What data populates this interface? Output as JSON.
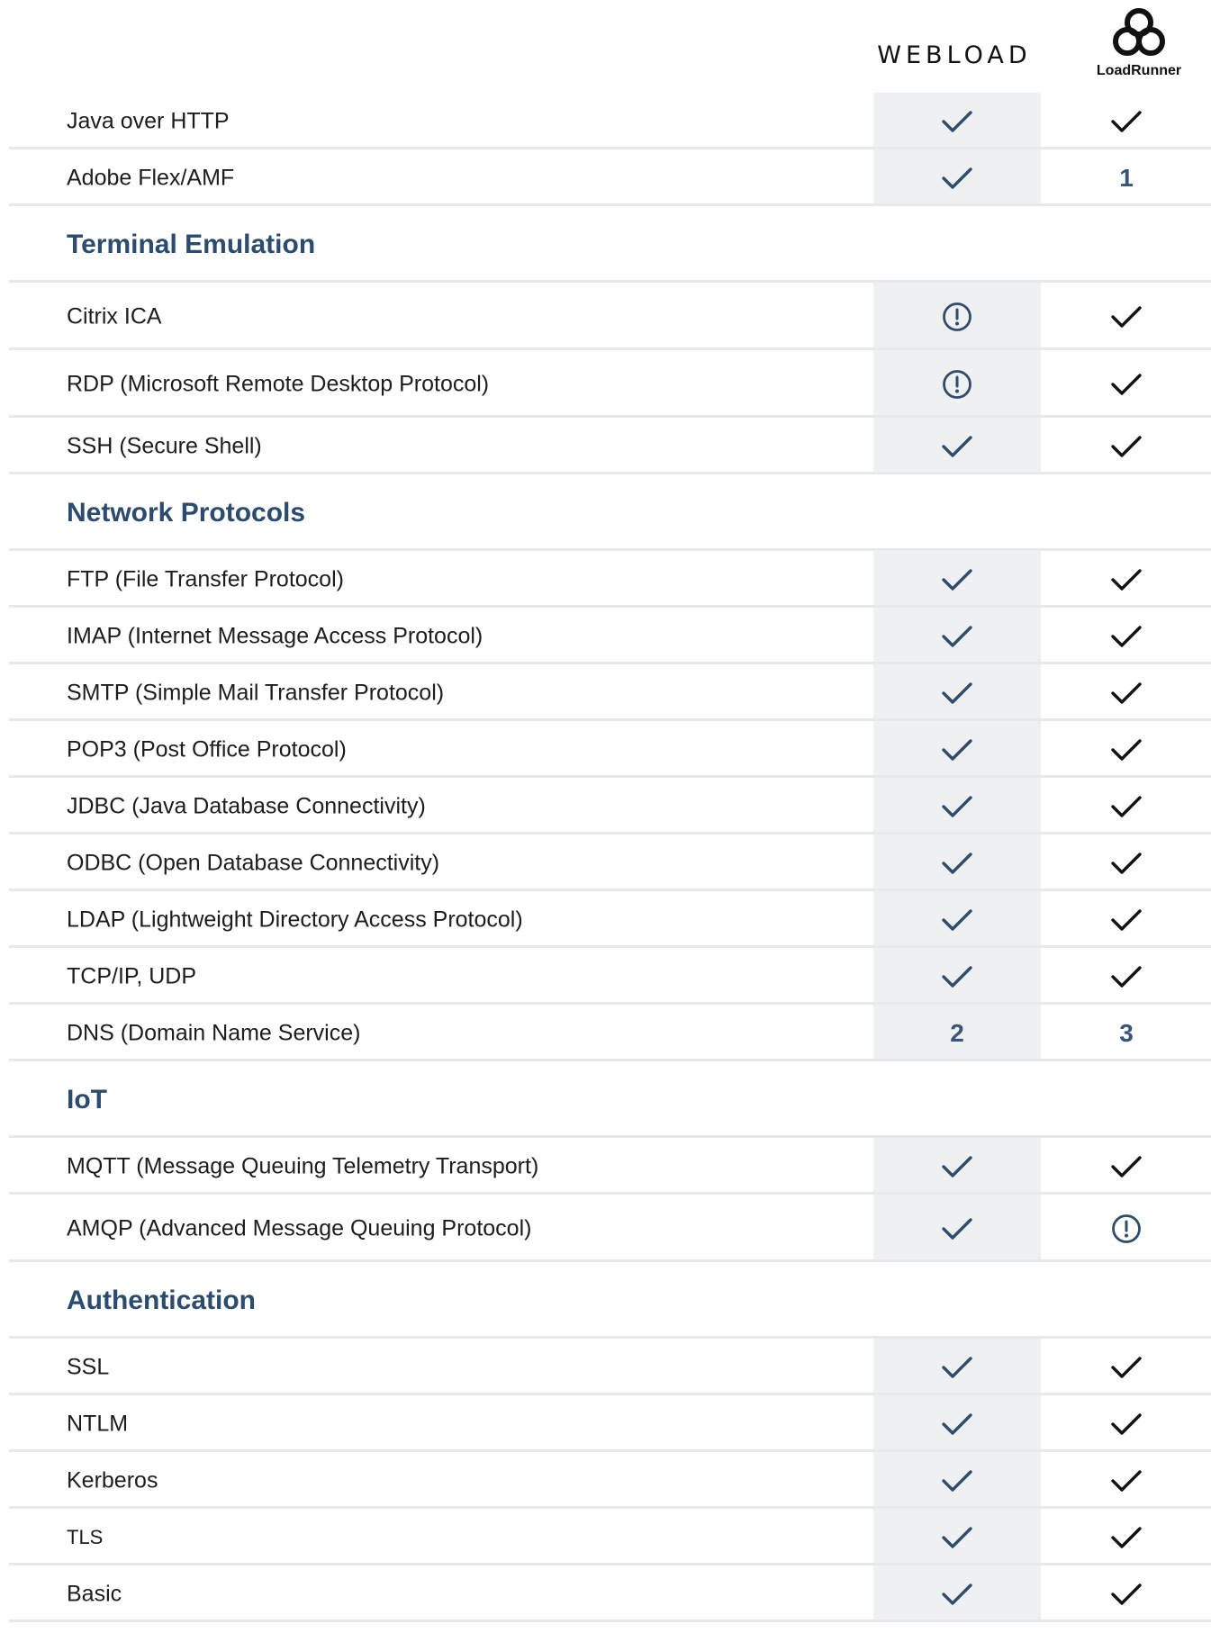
{
  "header": {
    "webload_logo": "WEBLOAD",
    "loadrunner_logo": "LoadRunner"
  },
  "colors": {
    "webload_check": "#2f4c6c",
    "loadrunner_check": "#111111",
    "section_heading": "#2b4b6f",
    "webload_column_bg": "#eff0f2",
    "row_divider": "#e7e8ea"
  },
  "rows": [
    {
      "type": "item",
      "label": "Java over HTTP",
      "webload": {
        "kind": "check"
      },
      "loadrunner": {
        "kind": "check"
      }
    },
    {
      "type": "item",
      "label": "Adobe Flex/AMF",
      "webload": {
        "kind": "check"
      },
      "loadrunner": {
        "kind": "text",
        "value": "1"
      }
    },
    {
      "type": "section",
      "label": "Terminal Emulation"
    },
    {
      "type": "item",
      "tall": true,
      "label": "Citrix ICA",
      "webload": {
        "kind": "warning"
      },
      "loadrunner": {
        "kind": "check"
      }
    },
    {
      "type": "item",
      "tall": true,
      "label": "RDP (Microsoft Remote Desktop Protocol)",
      "webload": {
        "kind": "warning"
      },
      "loadrunner": {
        "kind": "check"
      }
    },
    {
      "type": "item",
      "label": "SSH (Secure Shell)",
      "webload": {
        "kind": "check"
      },
      "loadrunner": {
        "kind": "check"
      }
    },
    {
      "type": "section",
      "label": "Network Protocols"
    },
    {
      "type": "item",
      "label": "FTP (File Transfer Protocol)",
      "webload": {
        "kind": "check"
      },
      "loadrunner": {
        "kind": "check"
      }
    },
    {
      "type": "item",
      "label": "IMAP (Internet Message Access Protocol)",
      "webload": {
        "kind": "check"
      },
      "loadrunner": {
        "kind": "check"
      }
    },
    {
      "type": "item",
      "label": "SMTP (Simple Mail Transfer Protocol)",
      "webload": {
        "kind": "check"
      },
      "loadrunner": {
        "kind": "check"
      }
    },
    {
      "type": "item",
      "label": "POP3 (Post Office Protocol)",
      "webload": {
        "kind": "check"
      },
      "loadrunner": {
        "kind": "check"
      }
    },
    {
      "type": "item",
      "label": "JDBC (Java Database Connectivity)",
      "webload": {
        "kind": "check"
      },
      "loadrunner": {
        "kind": "check"
      }
    },
    {
      "type": "item",
      "label": "ODBC (Open Database Connectivity)",
      "webload": {
        "kind": "check"
      },
      "loadrunner": {
        "kind": "check"
      }
    },
    {
      "type": "item",
      "label": "LDAP (Lightweight Directory Access Protocol)",
      "webload": {
        "kind": "check"
      },
      "loadrunner": {
        "kind": "check"
      }
    },
    {
      "type": "item",
      "label": "TCP/IP, UDP",
      "webload": {
        "kind": "check"
      },
      "loadrunner": {
        "kind": "check"
      }
    },
    {
      "type": "item",
      "label": "DNS (Domain Name Service)",
      "webload": {
        "kind": "text",
        "value": "2"
      },
      "loadrunner": {
        "kind": "text",
        "value": "3"
      }
    },
    {
      "type": "section",
      "label": "IoT"
    },
    {
      "type": "item",
      "label": "MQTT (Message Queuing Telemetry Transport)",
      "webload": {
        "kind": "check"
      },
      "loadrunner": {
        "kind": "check"
      }
    },
    {
      "type": "item",
      "tall": true,
      "label": "AMQP (Advanced Message Queuing Protocol)",
      "webload": {
        "kind": "check"
      },
      "loadrunner": {
        "kind": "warning"
      }
    },
    {
      "type": "section",
      "label": "Authentication"
    },
    {
      "type": "item",
      "label": "SSL",
      "webload": {
        "kind": "check"
      },
      "loadrunner": {
        "kind": "check"
      }
    },
    {
      "type": "item",
      "label": "NTLM",
      "webload": {
        "kind": "check"
      },
      "loadrunner": {
        "kind": "check"
      }
    },
    {
      "type": "item",
      "label": "Kerberos",
      "webload": {
        "kind": "check"
      },
      "loadrunner": {
        "kind": "check"
      }
    },
    {
      "type": "item",
      "small": true,
      "label": "TLS",
      "webload": {
        "kind": "check"
      },
      "loadrunner": {
        "kind": "check"
      }
    },
    {
      "type": "item",
      "label": "Basic",
      "webload": {
        "kind": "check"
      },
      "loadrunner": {
        "kind": "check"
      }
    }
  ]
}
